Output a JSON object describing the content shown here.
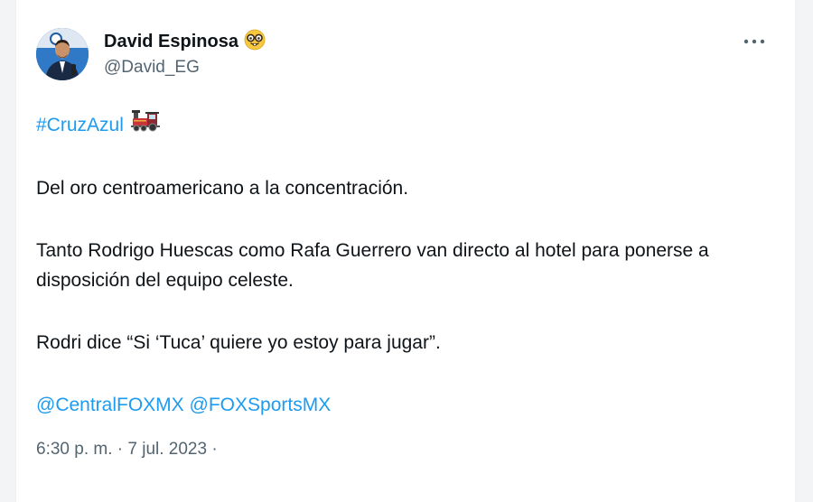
{
  "author": {
    "display_name": "David Espinosa",
    "handle": "@David_EG",
    "name_emoji": "nerd-face-icon"
  },
  "tweet": {
    "hashtag": "#CruzAzul",
    "hashtag_emoji": "locomotive-icon",
    "line1": "Del oro centroamericano a la concentración.",
    "line2": "Tanto Rodrigo Huescas como Rafa Guerrero van directo al hotel para ponerse a disposición del equipo celeste.",
    "line3": "Rodri dice “Si ‘Tuca’ quiere yo estoy para jugar”.",
    "mention1": "@CentralFOXMX",
    "mention2": "@FOXSportsMX"
  },
  "meta": {
    "timestamp": "6:30 p. m. · 7 jul. 2023 ·"
  },
  "colors": {
    "link": "#1d9bf0",
    "secondary_text": "#536471",
    "primary_text": "#0f1419"
  }
}
